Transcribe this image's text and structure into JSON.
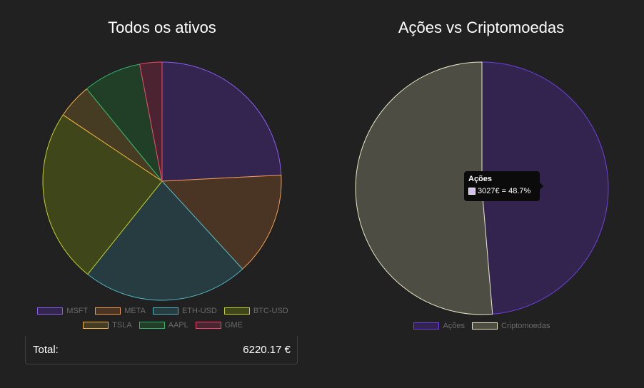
{
  "chart_data": [
    {
      "type": "pie",
      "title": "Todos os ativos",
      "categories": [
        "MSFT",
        "META",
        "ETH-USD",
        "BTC-USD",
        "TSLA",
        "AAPL",
        "GME"
      ],
      "values": [
        1505,
        872,
        1400,
        1472,
        294,
        490,
        187
      ],
      "colors": [
        "#8b5cf6",
        "#f59e4b",
        "#4fb3bf",
        "#c5d31b",
        "#f5b142",
        "#2fb36a",
        "#f0466b"
      ],
      "fills": [
        "#33254f",
        "#4a3424",
        "#263c40",
        "#3f461a",
        "#463c24",
        "#213e26",
        "#4b2331"
      ]
    },
    {
      "type": "pie",
      "title": "Ações vs Criptomoedas",
      "categories": [
        "Ações",
        "Criptomoedas"
      ],
      "values": [
        3027,
        3193
      ],
      "colors": [
        "#6e40e0",
        "#e7e7c2"
      ],
      "fills": [
        "#32234f",
        "#4d4d44"
      ]
    }
  ],
  "total": {
    "label": "Total:",
    "value": "6220.17 €"
  },
  "tooltip": {
    "title": "Ações",
    "body": "3027€  =  48.7%"
  }
}
